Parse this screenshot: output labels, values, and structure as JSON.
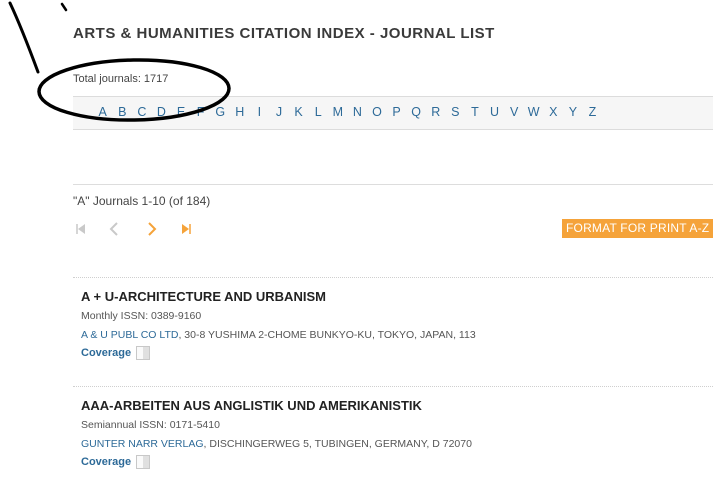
{
  "header": {
    "title": "ARTS & HUMANITIES CITATION INDEX - JOURNAL LIST",
    "total_journals": "Total journals: 1717"
  },
  "alphabet": [
    "A",
    "B",
    "C",
    "D",
    "E",
    "F",
    "G",
    "H",
    "I",
    "J",
    "K",
    "L",
    "M",
    "N",
    "O",
    "P",
    "Q",
    "R",
    "S",
    "T",
    "U",
    "V",
    "W",
    "X",
    "Y",
    "Z"
  ],
  "results": {
    "range_text": "\"A\" Journals 1-10 (of 184)",
    "print_button": "FORMAT FOR PRINT A-Z"
  },
  "pager": {
    "first_icon": "first-page-icon",
    "prev_icon": "prev-page-icon",
    "next_icon": "next-page-icon",
    "last_icon": "last-page-icon"
  },
  "journals": [
    {
      "title": "A + U-ARCHITECTURE AND URBANISM",
      "issn": "Monthly ISSN: 0389-9160",
      "publisher": "A & U PUBL CO LTD",
      "address": ", 30-8 YUSHIMA 2-CHOME BUNKYO-KU, TOKYO, JAPAN, 113",
      "coverage": "Coverage"
    },
    {
      "title": "AAA-ARBEITEN AUS ANGLISTIK UND AMERIKANISTIK",
      "issn": "Semiannual ISSN: 0171-5410",
      "publisher": "GUNTER NARR VERLAG",
      "address": ", DISCHINGERWEG 5, TUBINGEN, GERMANY, D 72070",
      "coverage": "Coverage"
    }
  ],
  "colors": {
    "link": "#2d6a98",
    "accent": "#f5a33a",
    "annotation": "#000000"
  }
}
